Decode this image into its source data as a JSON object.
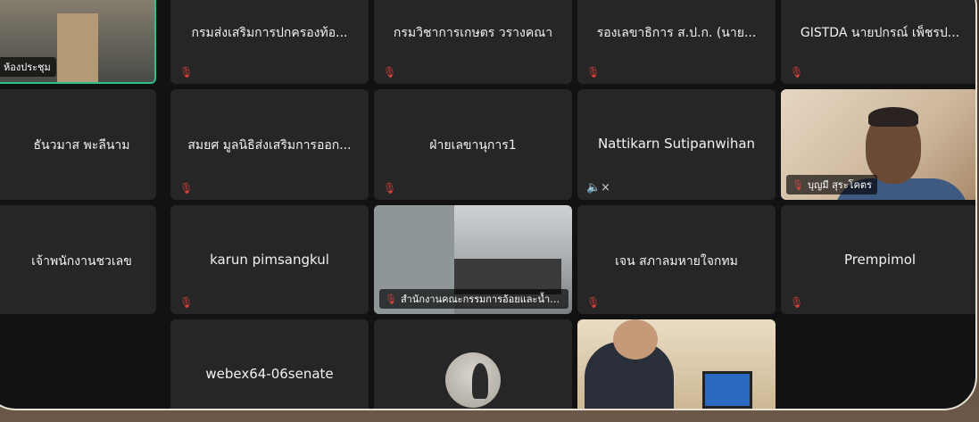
{
  "participants": [
    {
      "name": "ห้องประชุม",
      "type": "video-room",
      "label": "ห้องประชุม",
      "active": true
    },
    {
      "name": "กรมส่งเสริมการปกครองท้อ...",
      "muted": true
    },
    {
      "name": "กรมวิชาการเกษตร วรางคณา",
      "muted": true
    },
    {
      "name": "รองเลขาธิการ ส.ป.ก. (นาย...",
      "muted": true
    },
    {
      "name": "GISTDA นายปกรณ์ เพ็ชรป...",
      "muted": true
    },
    {
      "name": "ธันวมาส พะลีนาม",
      "muted": false
    },
    {
      "name": "สมยศ มูลนิธิส่งเสริมการออก...",
      "muted": true
    },
    {
      "name": "ฝ่ายเลขานุการ1",
      "muted": true
    },
    {
      "name": "Nattikarn Sutipanwihan",
      "speaker_off": true
    },
    {
      "name": "บุญมี สุระโคตร",
      "type": "video-man",
      "label": "บุญมี สุระโคตร"
    },
    {
      "name": "เจ้าพนักงานชวเลข",
      "muted": false
    },
    {
      "name": "karun pimsangkul",
      "muted": true
    },
    {
      "name": "สำนักงานคณะกรรมการอ้อยและน้ำตาลทราย",
      "type": "video-office",
      "label": "สำนักงานคณะกรรมการอ้อยและน้ำต..."
    },
    {
      "name": "เจน สภาลมหายใจกทม",
      "muted": true
    },
    {
      "name": "Prempimol",
      "muted": true
    },
    {
      "name": "webex64-06senate"
    },
    {
      "name": "",
      "type": "avatar"
    },
    {
      "name": "",
      "type": "video-elder"
    }
  ],
  "icons": {
    "muted": "mic-muted-icon",
    "speaker": "speaker-muted-icon"
  },
  "colors": {
    "tile": "#262626",
    "background": "#121212",
    "muted": "#e0413c",
    "active_border": "#2fbf8a"
  }
}
